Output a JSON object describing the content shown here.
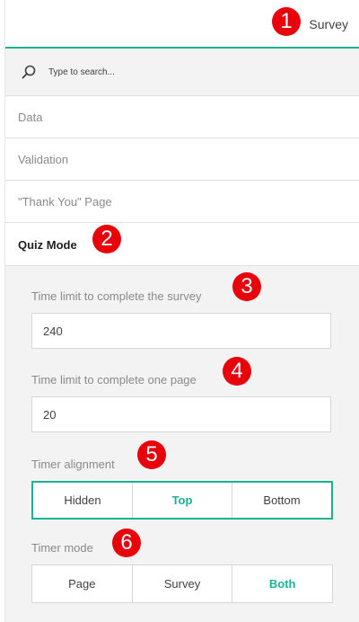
{
  "header": {
    "title": "Survey"
  },
  "search": {
    "placeholder": "Type to search..."
  },
  "categories": [
    {
      "label": "Data"
    },
    {
      "label": "Validation"
    },
    {
      "label": "\"Thank You\" Page"
    },
    {
      "label": "Quiz Mode"
    }
  ],
  "quiz": {
    "time_limit_survey": {
      "label": "Time limit to complete the survey",
      "value": "240"
    },
    "time_limit_page": {
      "label": "Time limit to complete one page",
      "value": "20"
    },
    "timer_alignment": {
      "label": "Timer alignment",
      "options": [
        "Hidden",
        "Top",
        "Bottom"
      ],
      "selected": "Top"
    },
    "timer_mode": {
      "label": "Timer mode",
      "options": [
        "Page",
        "Survey",
        "Both"
      ],
      "selected": "Both"
    }
  },
  "annotations": [
    "1",
    "2",
    "3",
    "4",
    "5",
    "6"
  ],
  "colors": {
    "accent": "#19b394",
    "annotation": "#e8000b",
    "panel": "#f3f3f3"
  }
}
